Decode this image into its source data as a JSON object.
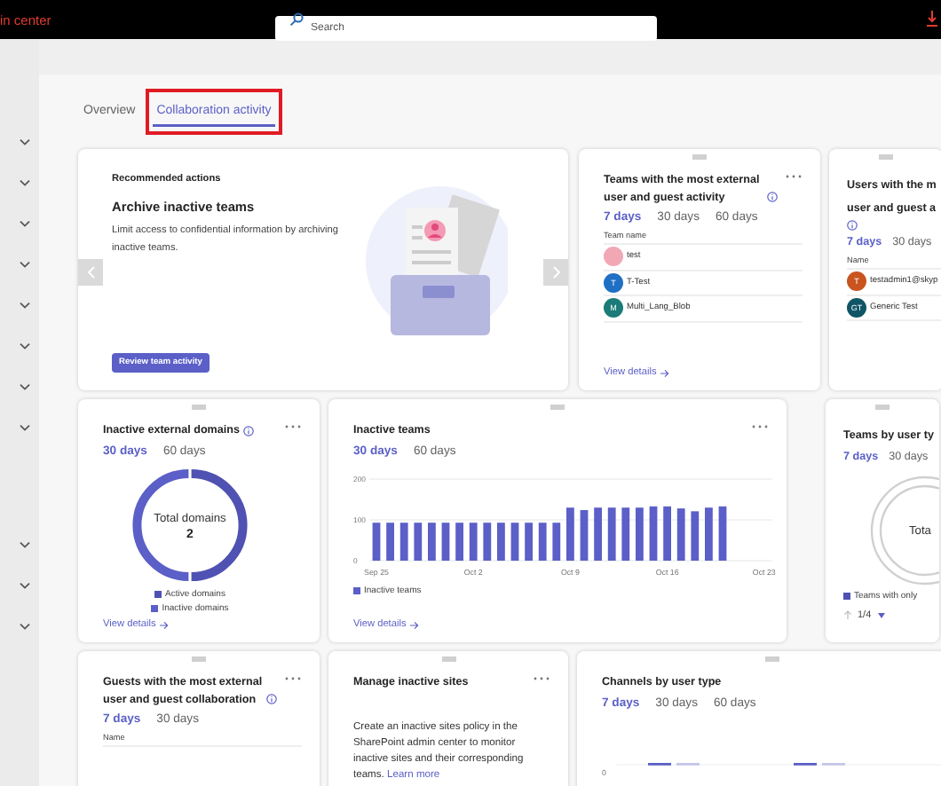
{
  "app_bar": {
    "title": "in center",
    "search": {
      "placeholder": "Search"
    }
  },
  "tabs": [
    {
      "label": "Overview",
      "selected": false,
      "highlighted": false
    },
    {
      "label": "Collaboration activity",
      "selected": true,
      "highlighted": true
    }
  ],
  "rows": [
    {
      "cards": [
        {
          "kind": "recommendation",
          "heading": "Recommended actions",
          "title": "Archive inactive teams",
          "text": "Limit access to confidential information by archiving inactive teams.",
          "button": "Review team activity"
        },
        {
          "kind": "list",
          "title": "Teams with the most external user and guest activity",
          "info": true,
          "menu": true,
          "periods": [
            {
              "label": "7 days",
              "selected": true
            },
            {
              "label": "30 days",
              "selected": false
            },
            {
              "label": "60 days",
              "selected": false
            }
          ],
          "column": "Team name",
          "items": [
            {
              "name": "test",
              "color": "#f2a7b5"
            },
            {
              "initials": "T",
              "name": "T-Test",
              "color": "#1f6fc5"
            },
            {
              "initials": "M",
              "name": "Multi_Lang_Blob",
              "color": "#1b7b78"
            }
          ],
          "link": "View details"
        },
        {
          "kind": "list",
          "title": "Users with the m\nuser and guest a",
          "info": true,
          "periods": [
            {
              "label": "7 days",
              "selected": true
            },
            {
              "label": "30 days",
              "selected": false
            }
          ],
          "column": "Name",
          "items": [
            {
              "initials": "T",
              "name": "testadmin1@skyp",
              "color": "#c9541f"
            },
            {
              "initials": "GT",
              "name": "Generic Test",
              "color": "#0f5566"
            }
          ]
        }
      ]
    },
    {
      "cards": [
        {
          "kind": "donut",
          "title": "Inactive external domains",
          "info": true,
          "menu": true,
          "periods": [
            {
              "label": "30 days",
              "selected": true
            },
            {
              "label": "60 days",
              "selected": false
            }
          ],
          "center_label": "Total domains",
          "center_value": "2",
          "legend": [
            {
              "label": "Active domains",
              "color": "#4f52b2"
            },
            {
              "label": "Inactive domains",
              "color": "#5b5fc7"
            }
          ],
          "link": "View details"
        },
        {
          "kind": "bar_chart",
          "title": "Inactive teams",
          "menu": true,
          "periods": [
            {
              "label": "30 days",
              "selected": true
            },
            {
              "label": "60 days",
              "selected": false
            }
          ],
          "chart_data": {
            "type": "bar",
            "categories": [
              "Sep 25",
              null,
              null,
              null,
              null,
              null,
              null,
              "Oct 2",
              null,
              null,
              null,
              null,
              null,
              null,
              "Oct 9",
              null,
              null,
              null,
              null,
              null,
              null,
              "Oct 16",
              null,
              null,
              null,
              null,
              null,
              null,
              "Oct 23"
            ],
            "series": [
              {
                "name": "Inactive teams",
                "color": "#5b5fc7",
                "values": [
                  93,
                  93,
                  93,
                  93,
                  93,
                  93,
                  93,
                  93,
                  93,
                  93,
                  93,
                  93,
                  93,
                  93,
                  130,
                  124,
                  130,
                  130,
                  130,
                  130,
                  133,
                  133,
                  128,
                  121,
                  130,
                  133,
                  null,
                  null,
                  null
                ]
              }
            ],
            "ylim": [
              0,
              200
            ],
            "yticks": [
              0,
              100,
              200
            ]
          },
          "link": "View details"
        },
        {
          "kind": "rings",
          "title": "Teams by user ty",
          "periods": [
            {
              "label": "7 days",
              "selected": true
            },
            {
              "label": "30 days",
              "selected": false
            }
          ],
          "center_label": "Tota",
          "legend": [
            {
              "label": "Teams with only",
              "color": "#4f52b2"
            }
          ],
          "pager": "1/4"
        }
      ]
    },
    {
      "cards": [
        {
          "kind": "list",
          "title": "Guests with the most external user and guest collaboration",
          "info": true,
          "menu": true,
          "periods": [
            {
              "label": "7 days",
              "selected": true
            },
            {
              "label": "30 days",
              "selected": false
            }
          ],
          "column": "Name"
        },
        {
          "kind": "text",
          "title": "Manage inactive sites",
          "menu": true,
          "text": "Create an inactive sites policy in the SharePoint admin center to monitor inactive sites and their corresponding teams.",
          "link": "Learn more"
        },
        {
          "kind": "channels",
          "title": "Channels by user type",
          "periods": [
            {
              "label": "7 days",
              "selected": true
            },
            {
              "label": "30 days",
              "selected": false
            },
            {
              "label": "60 days",
              "selected": false
            }
          ],
          "axis_label": "0"
        }
      ]
    }
  ]
}
